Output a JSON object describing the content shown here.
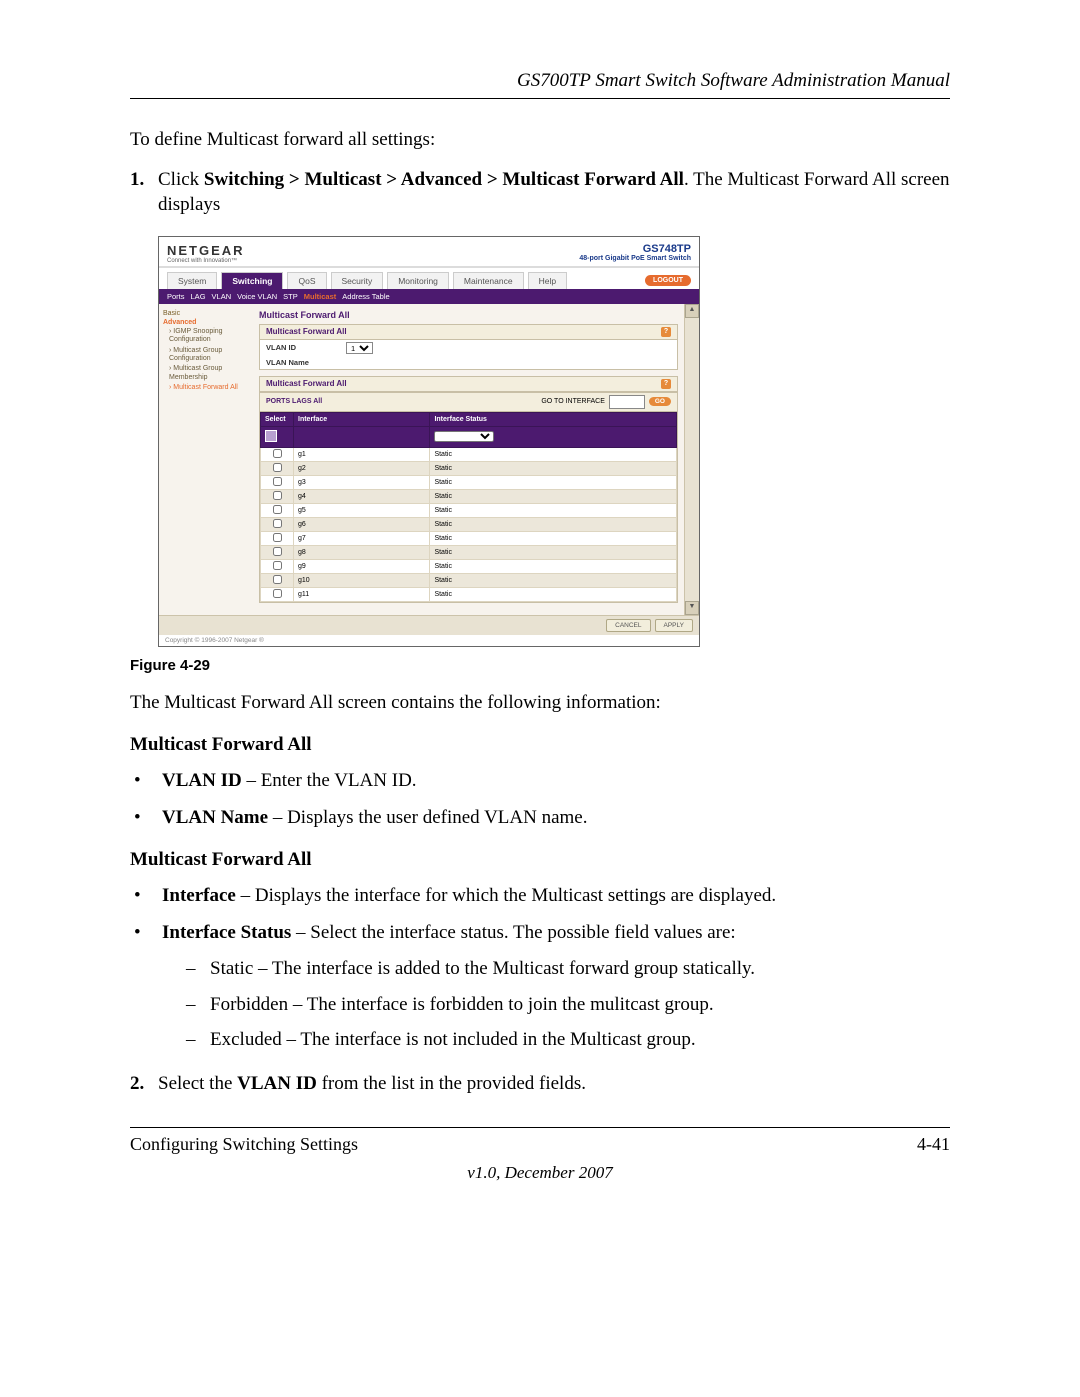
{
  "header": {
    "manual_title": "GS700TP Smart Switch Software Administration Manual"
  },
  "intro": "To define Multicast forward all settings:",
  "step1": {
    "num": "1.",
    "lead": "Click ",
    "bold_path": "Switching > Multicast > Advanced > Multicast Forward All",
    "tail": ". The Multicast Forward All screen displays"
  },
  "screenshot": {
    "brand": "NETGEAR",
    "tagline": "Connect with Innovation™",
    "model": "GS748TP",
    "model_sub": "48-port Gigabit PoE Smart Switch",
    "main_tabs": [
      "System",
      "Switching",
      "QoS",
      "Security",
      "Monitoring",
      "Maintenance",
      "Help"
    ],
    "active_main_tab": "Switching",
    "logout": "LOGOUT",
    "sub_tabs": [
      "Ports",
      "LAG",
      "VLAN",
      "Voice VLAN",
      "STP",
      "Multicast",
      "Address Table"
    ],
    "active_sub_tab": "Multicast",
    "sidebar": {
      "basic": "Basic",
      "advanced": "Advanced",
      "items": [
        "IGMP Snooping Configuration",
        "Multicast Group Configuration",
        "Multicast Group Membership",
        "Multicast Forward All"
      ],
      "active_item": "Multicast Forward All"
    },
    "panel": {
      "title": "Multicast Forward All",
      "box1_head": "Multicast Forward All",
      "vlan_id_label": "VLAN ID",
      "vlan_id_value": "1",
      "vlan_name_label": "VLAN Name",
      "box2_head": "Multicast Forward All",
      "ports_lags": "PORTS LAGS All",
      "goto_label": "GO TO INTERFACE",
      "go_btn": "GO",
      "cols": [
        "Select",
        "Interface",
        "Interface Status"
      ],
      "rows": [
        {
          "iface": "g1",
          "status": "Static"
        },
        {
          "iface": "g2",
          "status": "Static"
        },
        {
          "iface": "g3",
          "status": "Static"
        },
        {
          "iface": "g4",
          "status": "Static"
        },
        {
          "iface": "g5",
          "status": "Static"
        },
        {
          "iface": "g6",
          "status": "Static"
        },
        {
          "iface": "g7",
          "status": "Static"
        },
        {
          "iface": "g8",
          "status": "Static"
        },
        {
          "iface": "g9",
          "status": "Static"
        },
        {
          "iface": "g10",
          "status": "Static"
        },
        {
          "iface": "g11",
          "status": "Static"
        }
      ]
    },
    "cancel": "CANCEL",
    "apply": "APPLY",
    "copyright": "Copyright © 1996-2007 Netgear ®"
  },
  "figure_caption": "Figure 4-29",
  "after_fig": "The Multicast Forward All screen contains the following information:",
  "sec1_head": "Multicast Forward All",
  "sec1_b1": {
    "bold": "VLAN ID",
    "text": " – Enter the VLAN ID."
  },
  "sec1_b2": {
    "bold": "VLAN Name",
    "text": " – Displays the user defined VLAN name."
  },
  "sec2_head": "Multicast Forward All",
  "sec2_b1": {
    "bold": "Interface",
    "text": " – Displays the interface for which the Multicast settings are displayed."
  },
  "sec2_b2": {
    "bold": "Interface Status",
    "text": " – Select the interface status. The possible field values are:"
  },
  "sec2_d1": "Static – The interface is added to the Multicast forward group statically.",
  "sec2_d2": "Forbidden – The interface is forbidden to join the mulitcast group.",
  "sec2_d3": "Excluded – The interface is not included in the Multicast group.",
  "step2": {
    "num": "2.",
    "lead": "Select the ",
    "bold": "VLAN ID",
    "tail": " from the list in the provided fields."
  },
  "footer": {
    "left": "Configuring Switching Settings",
    "right": "4-41",
    "version": "v1.0, December 2007"
  }
}
